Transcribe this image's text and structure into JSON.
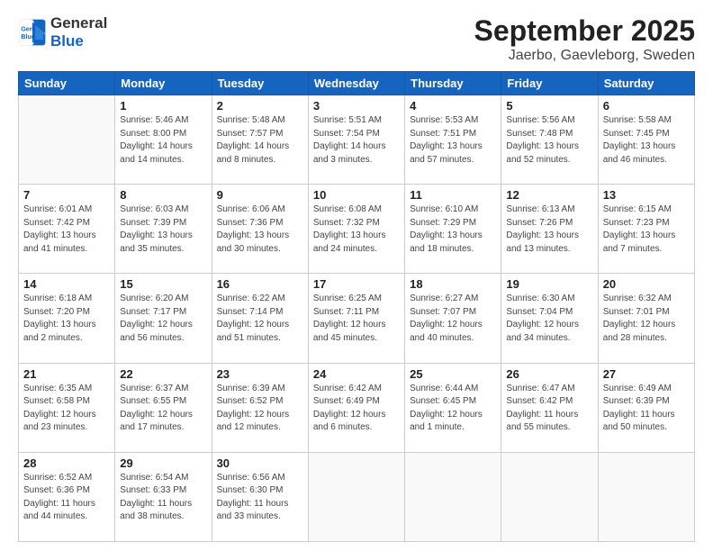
{
  "logo": {
    "line1": "General",
    "line2": "Blue"
  },
  "title": "September 2025",
  "subtitle": "Jaerbo, Gaevleborg, Sweden",
  "days_of_week": [
    "Sunday",
    "Monday",
    "Tuesday",
    "Wednesday",
    "Thursday",
    "Friday",
    "Saturday"
  ],
  "weeks": [
    [
      {
        "day": "",
        "info": ""
      },
      {
        "day": "1",
        "info": "Sunrise: 5:46 AM\nSunset: 8:00 PM\nDaylight: 14 hours\nand 14 minutes."
      },
      {
        "day": "2",
        "info": "Sunrise: 5:48 AM\nSunset: 7:57 PM\nDaylight: 14 hours\nand 8 minutes."
      },
      {
        "day": "3",
        "info": "Sunrise: 5:51 AM\nSunset: 7:54 PM\nDaylight: 14 hours\nand 3 minutes."
      },
      {
        "day": "4",
        "info": "Sunrise: 5:53 AM\nSunset: 7:51 PM\nDaylight: 13 hours\nand 57 minutes."
      },
      {
        "day": "5",
        "info": "Sunrise: 5:56 AM\nSunset: 7:48 PM\nDaylight: 13 hours\nand 52 minutes."
      },
      {
        "day": "6",
        "info": "Sunrise: 5:58 AM\nSunset: 7:45 PM\nDaylight: 13 hours\nand 46 minutes."
      }
    ],
    [
      {
        "day": "7",
        "info": "Sunrise: 6:01 AM\nSunset: 7:42 PM\nDaylight: 13 hours\nand 41 minutes."
      },
      {
        "day": "8",
        "info": "Sunrise: 6:03 AM\nSunset: 7:39 PM\nDaylight: 13 hours\nand 35 minutes."
      },
      {
        "day": "9",
        "info": "Sunrise: 6:06 AM\nSunset: 7:36 PM\nDaylight: 13 hours\nand 30 minutes."
      },
      {
        "day": "10",
        "info": "Sunrise: 6:08 AM\nSunset: 7:32 PM\nDaylight: 13 hours\nand 24 minutes."
      },
      {
        "day": "11",
        "info": "Sunrise: 6:10 AM\nSunset: 7:29 PM\nDaylight: 13 hours\nand 18 minutes."
      },
      {
        "day": "12",
        "info": "Sunrise: 6:13 AM\nSunset: 7:26 PM\nDaylight: 13 hours\nand 13 minutes."
      },
      {
        "day": "13",
        "info": "Sunrise: 6:15 AM\nSunset: 7:23 PM\nDaylight: 13 hours\nand 7 minutes."
      }
    ],
    [
      {
        "day": "14",
        "info": "Sunrise: 6:18 AM\nSunset: 7:20 PM\nDaylight: 13 hours\nand 2 minutes."
      },
      {
        "day": "15",
        "info": "Sunrise: 6:20 AM\nSunset: 7:17 PM\nDaylight: 12 hours\nand 56 minutes."
      },
      {
        "day": "16",
        "info": "Sunrise: 6:22 AM\nSunset: 7:14 PM\nDaylight: 12 hours\nand 51 minutes."
      },
      {
        "day": "17",
        "info": "Sunrise: 6:25 AM\nSunset: 7:11 PM\nDaylight: 12 hours\nand 45 minutes."
      },
      {
        "day": "18",
        "info": "Sunrise: 6:27 AM\nSunset: 7:07 PM\nDaylight: 12 hours\nand 40 minutes."
      },
      {
        "day": "19",
        "info": "Sunrise: 6:30 AM\nSunset: 7:04 PM\nDaylight: 12 hours\nand 34 minutes."
      },
      {
        "day": "20",
        "info": "Sunrise: 6:32 AM\nSunset: 7:01 PM\nDaylight: 12 hours\nand 28 minutes."
      }
    ],
    [
      {
        "day": "21",
        "info": "Sunrise: 6:35 AM\nSunset: 6:58 PM\nDaylight: 12 hours\nand 23 minutes."
      },
      {
        "day": "22",
        "info": "Sunrise: 6:37 AM\nSunset: 6:55 PM\nDaylight: 12 hours\nand 17 minutes."
      },
      {
        "day": "23",
        "info": "Sunrise: 6:39 AM\nSunset: 6:52 PM\nDaylight: 12 hours\nand 12 minutes."
      },
      {
        "day": "24",
        "info": "Sunrise: 6:42 AM\nSunset: 6:49 PM\nDaylight: 12 hours\nand 6 minutes."
      },
      {
        "day": "25",
        "info": "Sunrise: 6:44 AM\nSunset: 6:45 PM\nDaylight: 12 hours\nand 1 minute."
      },
      {
        "day": "26",
        "info": "Sunrise: 6:47 AM\nSunset: 6:42 PM\nDaylight: 11 hours\nand 55 minutes."
      },
      {
        "day": "27",
        "info": "Sunrise: 6:49 AM\nSunset: 6:39 PM\nDaylight: 11 hours\nand 50 minutes."
      }
    ],
    [
      {
        "day": "28",
        "info": "Sunrise: 6:52 AM\nSunset: 6:36 PM\nDaylight: 11 hours\nand 44 minutes."
      },
      {
        "day": "29",
        "info": "Sunrise: 6:54 AM\nSunset: 6:33 PM\nDaylight: 11 hours\nand 38 minutes."
      },
      {
        "day": "30",
        "info": "Sunrise: 6:56 AM\nSunset: 6:30 PM\nDaylight: 11 hours\nand 33 minutes."
      },
      {
        "day": "",
        "info": ""
      },
      {
        "day": "",
        "info": ""
      },
      {
        "day": "",
        "info": ""
      },
      {
        "day": "",
        "info": ""
      }
    ]
  ]
}
